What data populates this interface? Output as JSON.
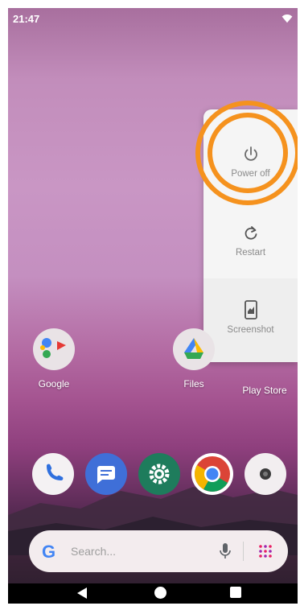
{
  "status_bar": {
    "time": "21:47",
    "wifi_icon": "wifi-icon"
  },
  "power_menu": {
    "items": [
      {
        "label": "Power off",
        "icon": "power-icon"
      },
      {
        "label": "Restart",
        "icon": "restart-icon"
      },
      {
        "label": "Screenshot",
        "icon": "screenshot-icon"
      }
    ],
    "highlight_color": "#f5921e"
  },
  "home_apps": [
    {
      "label": "Google",
      "icon": "google-folder-icon"
    },
    {
      "label": "Files",
      "icon": "files-icon"
    },
    {
      "label": "Play Store",
      "icon": "play-store-icon"
    }
  ],
  "dock": [
    {
      "icon": "phone-icon"
    },
    {
      "icon": "messages-icon"
    },
    {
      "icon": "settings-icon"
    },
    {
      "icon": "chrome-icon"
    },
    {
      "icon": "camera-icon"
    }
  ],
  "search_bar": {
    "placeholder": "Search..."
  },
  "nav_bar": {
    "back": "back-icon",
    "home": "home-icon",
    "recents": "recents-icon"
  }
}
